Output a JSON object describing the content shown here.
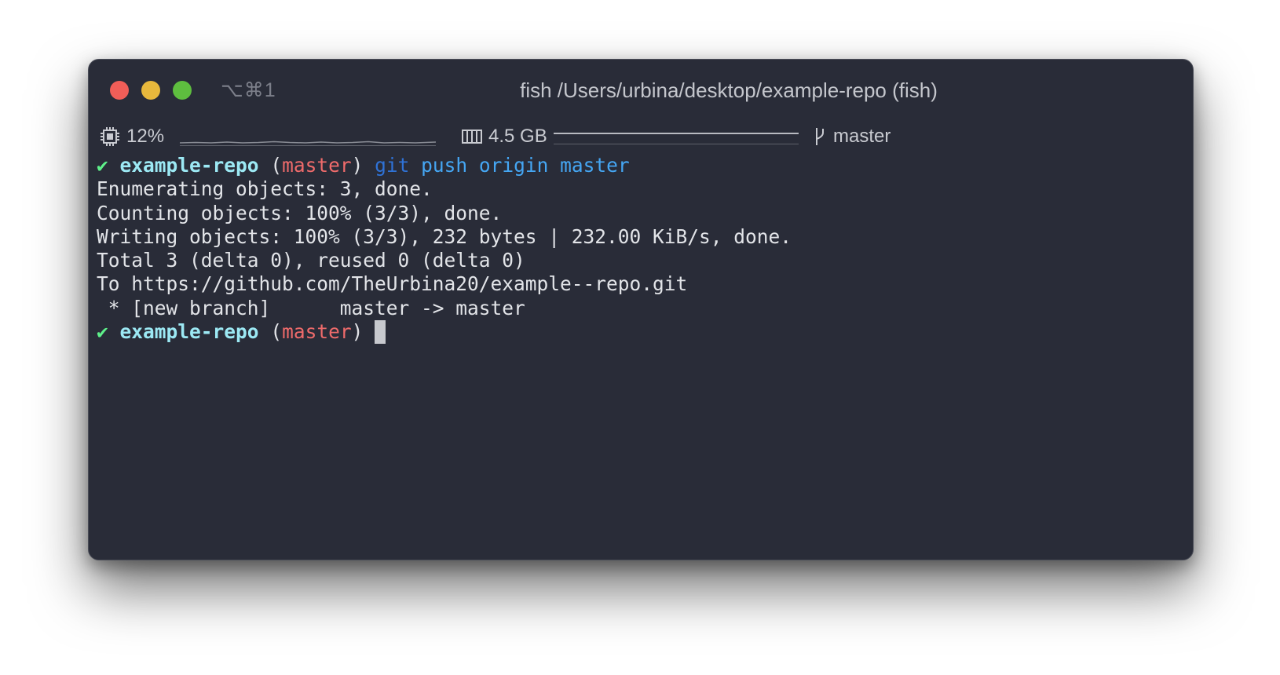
{
  "window": {
    "shortcut": "⌥⌘1",
    "title": "fish /Users/urbina/desktop/example-repo (fish)"
  },
  "status": {
    "cpu_icon": "cpu-chip-icon",
    "cpu_percent": "12%",
    "memory_icon": "memory-chip-icon",
    "memory": "4.5 GB",
    "branch_icon": "git-branch-icon",
    "branch": "master"
  },
  "terminal": {
    "prompt1": {
      "check": "✔",
      "dir": "example-repo",
      "open_paren": "(",
      "branch": "master",
      "close_paren": ")",
      "cmd": "git",
      "args": "push origin master"
    },
    "output": [
      "Enumerating objects: 3, done.",
      "Counting objects: 100% (3/3), done.",
      "Writing objects: 100% (3/3), 232 bytes | 232.00 KiB/s, done.",
      "Total 3 (delta 0), reused 0 (delta 0)",
      "To https://github.com/TheUrbina20/example--repo.git",
      " * [new branch]      master -> master"
    ],
    "prompt2": {
      "check": "✔",
      "dir": "example-repo",
      "open_paren": "(",
      "branch": "master",
      "close_paren": ")"
    }
  }
}
